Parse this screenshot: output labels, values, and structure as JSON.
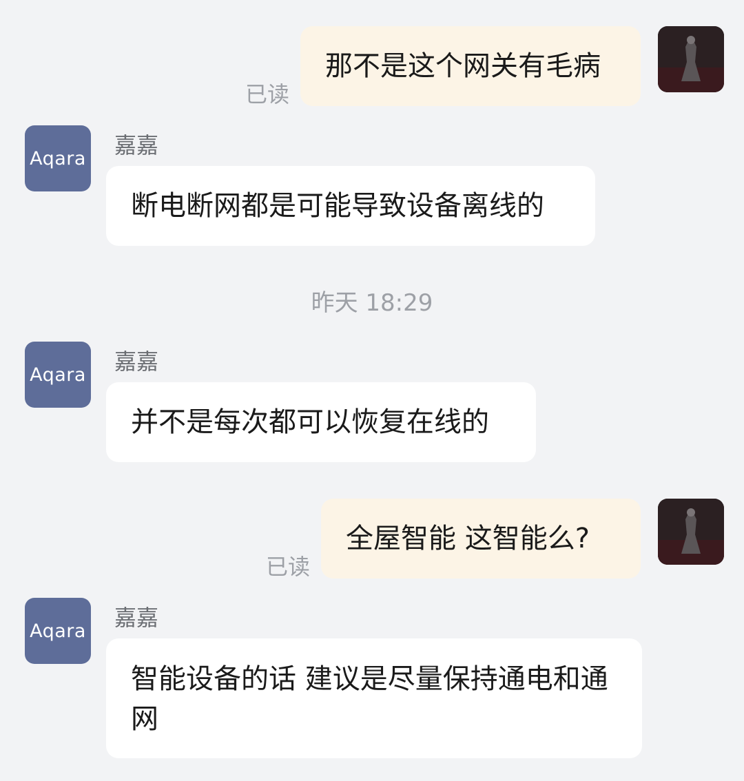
{
  "conversation": {
    "messages": [
      {
        "direction": "out",
        "text": "那不是这个网关有毛病",
        "status": "已读"
      },
      {
        "direction": "in",
        "sender": "嘉嘉",
        "avatar_text": "Aqara",
        "text": "断电断网都是可能导致设备离线的"
      },
      {
        "direction": "in",
        "sender": "嘉嘉",
        "avatar_text": "Aqara",
        "text": "并不是每次都可以恢复在线的"
      },
      {
        "direction": "out",
        "text": "全屋智能 这智能么?",
        "status": "已读"
      },
      {
        "direction": "in",
        "sender": "嘉嘉",
        "avatar_text": "Aqara",
        "text": "智能设备的话 建议是尽量保持通电和通网"
      }
    ],
    "timestamp": "昨天  18:29"
  },
  "colors": {
    "background": "#f2f3f5",
    "outgoing_bubble": "#fcf4e6",
    "incoming_bubble": "#ffffff",
    "brand_avatar": "#5e6d99"
  }
}
